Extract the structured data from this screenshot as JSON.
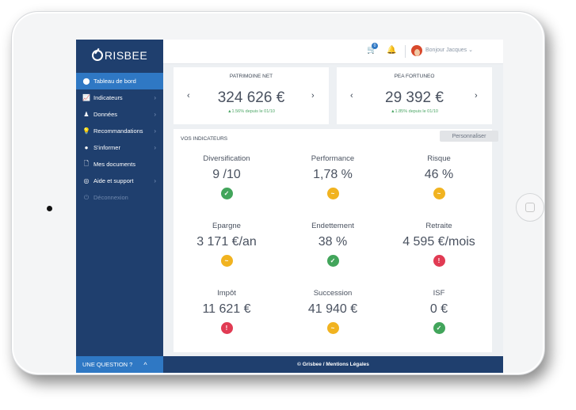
{
  "app": {
    "brand": "RISBEE"
  },
  "sidebar": {
    "items": [
      {
        "label": "Tableau de bord",
        "icon": "dashboard-icon",
        "glyph": "⬤"
      },
      {
        "label": "Indicateurs",
        "icon": "chart-icon",
        "glyph": "📈",
        "chevron": "›"
      },
      {
        "label": "Données",
        "icon": "data-icon",
        "glyph": "♟",
        "chevron": "›"
      },
      {
        "label": "Recommandations",
        "icon": "lightbulb-icon",
        "glyph": "💡",
        "chevron": "›"
      },
      {
        "label": "S'informer",
        "icon": "info-icon",
        "glyph": "●",
        "chevron": "›"
      },
      {
        "label": "Mes documents",
        "icon": "document-icon",
        "glyph": "🗋"
      },
      {
        "label": "Aide et support",
        "icon": "help-icon",
        "glyph": "◎",
        "chevron": "›"
      },
      {
        "label": "Déconnexion",
        "icon": "power-icon",
        "glyph": "⏻"
      }
    ],
    "question": {
      "label": "UNE QUESTION ?",
      "chevron": "^"
    }
  },
  "topbar": {
    "cart_count": "0",
    "greeting": "Bonjour Jacques ⌄"
  },
  "cards": {
    "patrimoine": {
      "title": "PATRIMOINE NET",
      "value": "324 626 €",
      "delta": "▲1.56% depuis le 01/10"
    },
    "pea": {
      "title": "PEA FORTUNEO",
      "value": "29 392 €",
      "delta": "▲1.85% depuis le 01/10"
    }
  },
  "indicators": {
    "header": "VOS INDICATEURS",
    "customize": "Personnaliser",
    "items": [
      {
        "name": "Diversification",
        "value": "9 /10",
        "status": "ok",
        "glyph": "✓"
      },
      {
        "name": "Performance",
        "value": "1,78 %",
        "status": "warn",
        "glyph": "~"
      },
      {
        "name": "Risque",
        "value": "46 %",
        "status": "warn",
        "glyph": "~"
      },
      {
        "name": "Epargne",
        "value": "3 171 €/an",
        "status": "warn",
        "glyph": "~"
      },
      {
        "name": "Endettement",
        "value": "38 %",
        "status": "ok",
        "glyph": "✓"
      },
      {
        "name": "Retraite",
        "value": "4 595 €/mois",
        "status": "bad",
        "glyph": "!"
      },
      {
        "name": "Impôt",
        "value": "11 621 €",
        "status": "bad",
        "glyph": "!"
      },
      {
        "name": "Succession",
        "value": "41 940 €",
        "status": "warn",
        "glyph": "~"
      },
      {
        "name": "ISF",
        "value": "0 €",
        "status": "ok",
        "glyph": "✓"
      }
    ]
  },
  "footer": {
    "text": "© Grisbee  /  Mentions Légales"
  },
  "colors": {
    "sidebar": "#1f3f6e",
    "accent": "#2f78c4",
    "ok": "#42a55b",
    "warn": "#f1b320",
    "bad": "#e13b53"
  }
}
